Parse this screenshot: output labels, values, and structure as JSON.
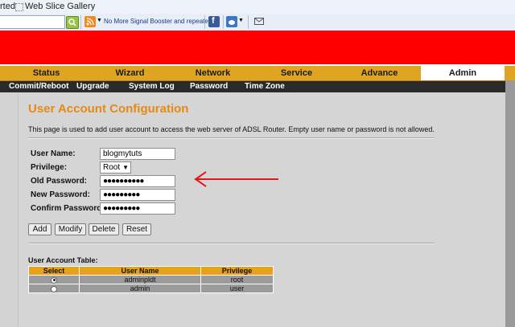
{
  "browser": {
    "fav_partial": "rted",
    "web_slice": "Web Slice Gallery",
    "tab_title": "No More Signal Booster and repeaters"
  },
  "mainnav": [
    "Status",
    "Wizard",
    "Network",
    "Service",
    "Advance",
    "Admin"
  ],
  "subnav": [
    "Commit/Reboot",
    "Upgrade",
    "System Log",
    "Password",
    "Time Zone"
  ],
  "page": {
    "title": "User Account Configuration",
    "description": "This page is used to add user account to access the web server of ADSL Router. Empty user name or password is not allowed."
  },
  "form": {
    "username_label": "User Name:",
    "username_value": "blogmytuts",
    "privilege_label": "Privilege:",
    "privilege_value": "Root",
    "oldpw_label": "Old Password:",
    "oldpw_value": "●●●●●●●●●●",
    "newpw_label": "New Password:",
    "newpw_value": "●●●●●●●●●",
    "confirmpw_label": "Confirm Password:",
    "confirmpw_value": "●●●●●●●●●"
  },
  "buttons": {
    "add": "Add",
    "modify": "Modify",
    "delete": "Delete",
    "reset": "Reset"
  },
  "table": {
    "title": "User Account Table:",
    "headers": [
      "Select",
      "User Name",
      "Privilege"
    ],
    "rows": [
      {
        "user": "adminpldt",
        "privilege": "root",
        "selected": true
      },
      {
        "user": "admin",
        "privilege": "user",
        "selected": false
      }
    ]
  },
  "colors": {
    "banner": "#ff0000",
    "nav": "#e0a423",
    "title": "#e68a16",
    "arrow": "#e8141b"
  }
}
